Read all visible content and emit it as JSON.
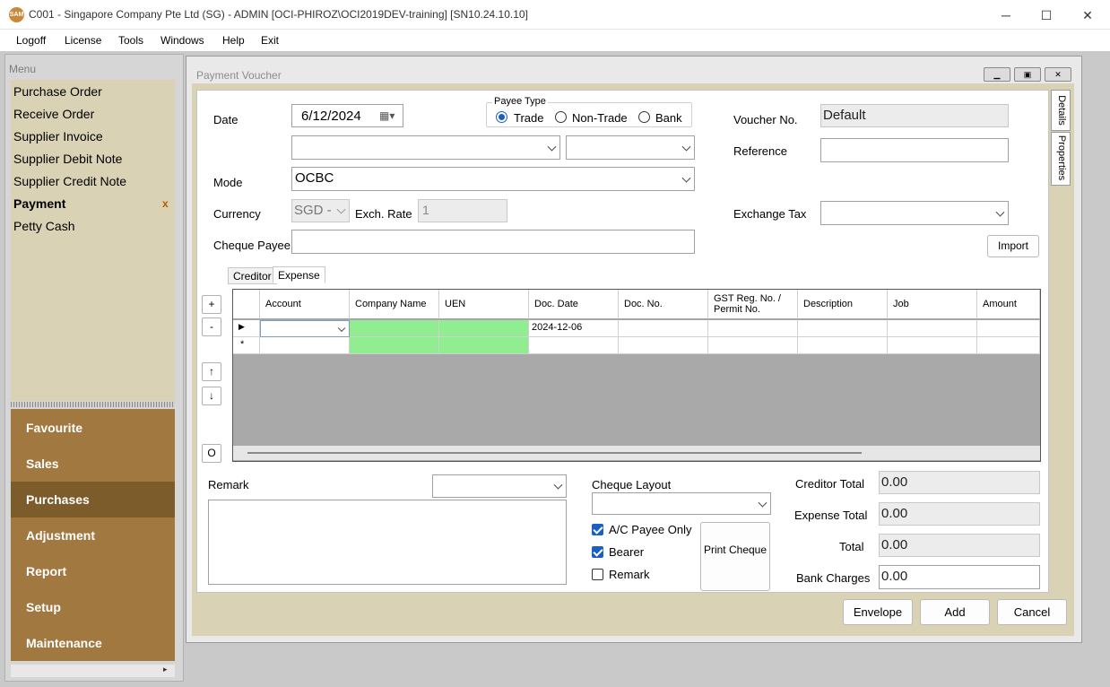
{
  "window": {
    "logo": "SAM",
    "title": "C001 - Singapore Company Pte Ltd (SG) - ADMIN [OCI-PHIROZ\\OCI2019DEV-training] [SN10.24.10.10]",
    "minimize_icon": "─",
    "maximize_icon": "☐",
    "close_icon": "✕"
  },
  "menubar": [
    "Logoff",
    "License",
    "Tools",
    "Windows",
    "Help",
    "Exit"
  ],
  "sidebar": {
    "heading": "Menu",
    "items": [
      "Purchase Order",
      "Receive Order",
      "Supplier Invoice",
      "Supplier Debit Note",
      "Supplier Credit Note",
      "Payment",
      "Petty Cash"
    ],
    "active_close": "x",
    "groups": [
      "Favourite",
      "Sales",
      "Purchases",
      "Adjustment",
      "Report",
      "Setup",
      "Maintenance"
    ],
    "scroll_arrow": "▸"
  },
  "child": {
    "title": "Payment Voucher",
    "side_tabs": [
      "Details",
      "Properties"
    ]
  },
  "form": {
    "date_label": "Date",
    "date_value": "6/12/2024",
    "payee_type_label": "Payee Type",
    "payee_options": [
      "Trade",
      "Non-Trade",
      "Bank"
    ],
    "mode_label": "Mode",
    "mode_value": "OCBC",
    "currency_label": "Currency",
    "currency_value": "SGD -",
    "exch_rate_label": "Exch. Rate",
    "exch_rate_value": "1",
    "cheque_payee_label": "Cheque Payee",
    "voucher_no_label": "Voucher No.",
    "voucher_no_value": "Default",
    "reference_label": "Reference",
    "exchange_tax_label": "Exchange Tax",
    "import_label": "Import"
  },
  "tabs": [
    "Creditor",
    "Expense"
  ],
  "grid": {
    "columns": [
      "Account",
      "Company Name",
      "UEN",
      "Doc. Date",
      "Doc. No.",
      "GST Reg. No. / Permit No.",
      "Description",
      "Job",
      "Amount"
    ],
    "row1_marker": "▶",
    "row1_doc_date": "2024-12-06",
    "new_row_marker": "*",
    "side_buttons": [
      "+",
      "-",
      "↑",
      "↓",
      "O"
    ]
  },
  "bottom": {
    "remark_label": "Remark",
    "cheque_layout_label": "Cheque Layout",
    "checkboxes": [
      {
        "label": "A/C Payee Only",
        "checked": true
      },
      {
        "label": "Bearer",
        "checked": true
      },
      {
        "label": "Remark",
        "checked": false
      }
    ],
    "print_cheque_label": "Print Cheque",
    "creditor_total_label": "Creditor Total",
    "creditor_total_value": "0.00",
    "expense_total_label": "Expense Total",
    "expense_total_value": "0.00",
    "total_label": "Total",
    "total_value": "0.00",
    "bank_charges_label": "Bank Charges",
    "bank_charges_value": "0.00"
  },
  "actions": {
    "envelope": "Envelope",
    "add": "Add",
    "cancel": "Cancel"
  },
  "colors": {
    "menu_bg": "#d9d2b4",
    "nav_bg": "#a07840",
    "nav_active": "#7d5c2c",
    "highlight_green": "#90ee90",
    "accent_blue": "#1a60c0"
  }
}
